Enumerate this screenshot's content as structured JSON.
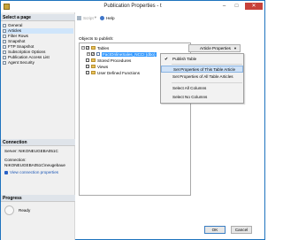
{
  "window": {
    "title": "Publication Properties - t",
    "controls": {
      "minimize": "‒",
      "maximize": "□",
      "close": "✕"
    }
  },
  "left_panel": {
    "pages_header": "Select a page",
    "pages": [
      {
        "label": "General",
        "selected": false
      },
      {
        "label": "Articles",
        "selected": true
      },
      {
        "label": "Filter Rows",
        "selected": false
      },
      {
        "label": "Snapshot",
        "selected": false
      },
      {
        "label": "FTP Snapshot",
        "selected": false
      },
      {
        "label": "Subscription Options",
        "selected": false
      },
      {
        "label": "Publication Access List",
        "selected": false
      },
      {
        "label": "Agent Security",
        "selected": false
      }
    ],
    "connection_header": "Connection",
    "server_line": "Server: NIKONEUGEBA051C",
    "connection_label": "Connection:",
    "connection_value": "NIKONEUGEBA051C\\neugebaue",
    "view_connection_link": "View connection properties",
    "progress_header": "Progress",
    "progress_status": "Ready"
  },
  "toolbar": {
    "script_label": "Script",
    "script_caret": "▾",
    "help_label": "Help"
  },
  "main": {
    "objects_label": "Objects to publish:",
    "tree": {
      "tables_label": "Tables",
      "selected_table": "FactOnlineSales_NCCI (dbo)",
      "stored_procedures_label": "Stored Procedures",
      "views_label": "Views",
      "udf_label": "User Defined Functions"
    },
    "article_properties_button": "Article Properties",
    "article_properties_caret": "▼",
    "menu": {
      "items": [
        {
          "label": "Publish Table",
          "checked": true,
          "hover": false
        },
        {
          "label": "Set Properties of This Table Article",
          "checked": false,
          "hover": true
        },
        {
          "label": "Set Properties of All Table Articles",
          "checked": false,
          "hover": false
        },
        {
          "label": "Select All Columns",
          "checked": false,
          "hover": false
        },
        {
          "label": "Select No Columns",
          "checked": false,
          "hover": false
        }
      ],
      "check_glyph": "✔"
    }
  },
  "buttons": {
    "ok": "OK",
    "cancel": "Cancel"
  },
  "colors": {
    "accent": "#3399ff",
    "close_button": "#c8423a",
    "link": "#1a56b5"
  }
}
